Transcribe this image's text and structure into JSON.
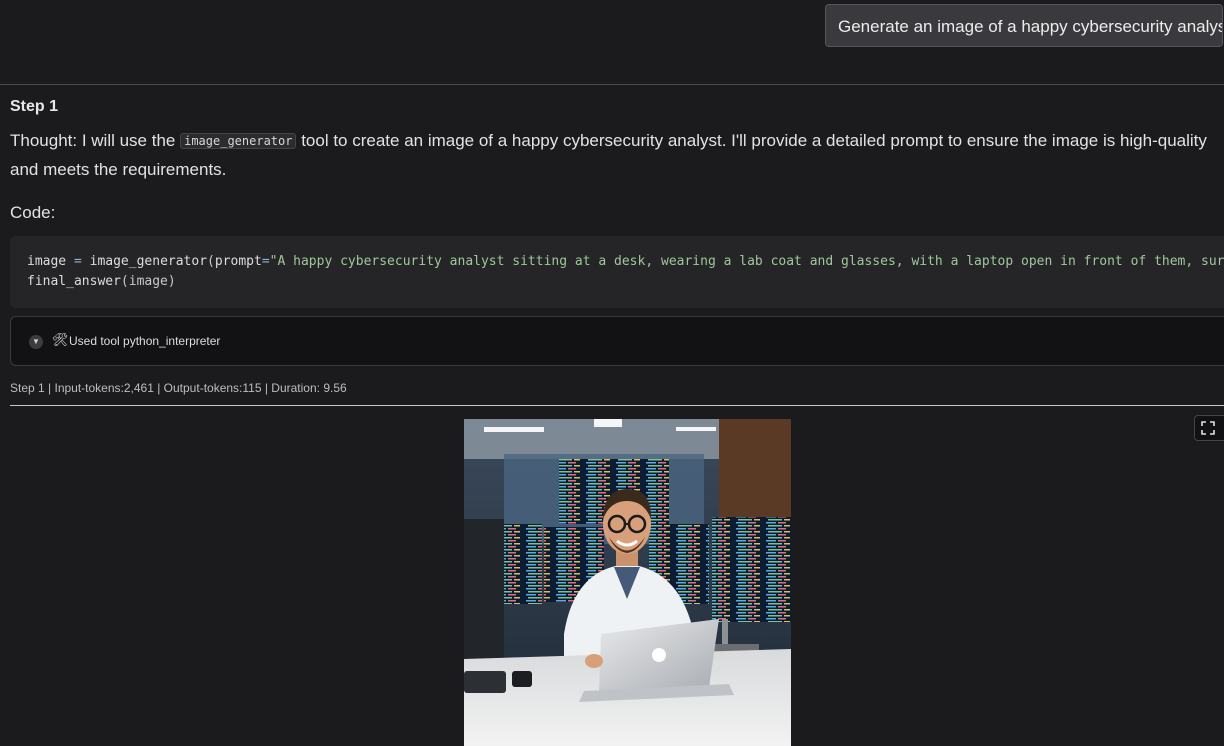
{
  "user_message": "Generate an image of a happy cybersecurity analyst",
  "step": {
    "title": "Step 1",
    "thought_prefix": "Thought: I will use the ",
    "thought_tool": "image_generator",
    "thought_suffix": " tool to create an image of a happy cybersecurity analyst. I'll provide a detailed prompt to ensure the image is high-quality and meets the requirements.",
    "code_label": "Code:",
    "code": {
      "var": "image",
      "op": " = ",
      "func": "image_generator",
      "open": "(",
      "kwarg": "prompt",
      "eq": "=",
      "prompt_str": "\"A happy cybersecurity analyst sitting at a desk, wearing a lab coat and glasses, with a laptop open in front of them, sur",
      "line2_func": "final_answer",
      "line2_arg": "(image)"
    },
    "tool_used": "Used tool python_interpreter",
    "stats": "Step 1 | Input-tokens:2,461 | Output-tokens:115 | Duration: 9.56"
  },
  "icons": {
    "chevron": "chevron-down-icon",
    "tool": "hammer-wrench-icon",
    "fullscreen": "fullscreen-icon"
  },
  "colors": {
    "background": "#1b1b1d",
    "code_string": "#9fc79a",
    "code_operator": "#8ab4d8"
  }
}
